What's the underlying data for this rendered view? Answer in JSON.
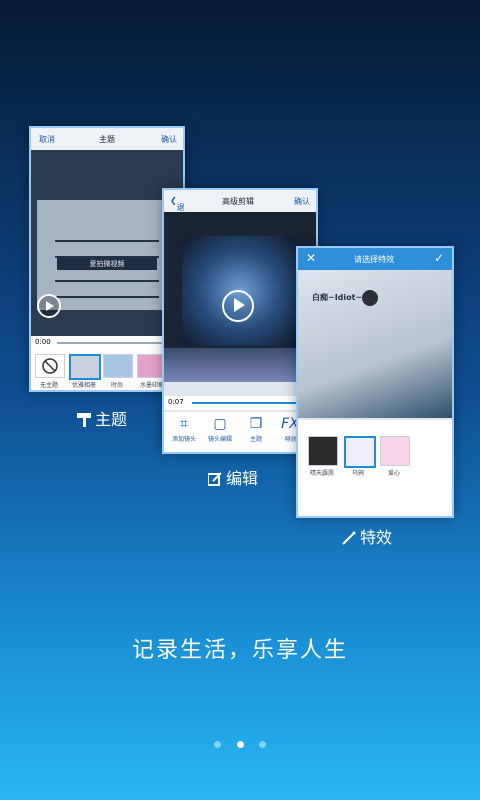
{
  "card_theme": {
    "cancel": "取消",
    "title": "主题",
    "confirm": "确认",
    "caption": "爱拍微视频",
    "time": "0:00",
    "items": [
      {
        "label": "无主题"
      },
      {
        "label": "优雅相册"
      },
      {
        "label": "时尚"
      },
      {
        "label": "水墨印象"
      }
    ]
  },
  "card_edit": {
    "back": "退出",
    "title": "高级剪辑",
    "confirm": "确认",
    "time": "0:07",
    "tools": [
      {
        "label": "添加镜头"
      },
      {
        "label": "镜头编辑"
      },
      {
        "label": "主题"
      },
      {
        "icon": "FX",
        "label": "特效"
      }
    ]
  },
  "card_effect": {
    "title": "请选择特效",
    "photo_text": "白痴~Idiot~",
    "items": [
      {
        "label": "晴天霹雳"
      },
      {
        "label": "乌鸦"
      },
      {
        "label": "爱心"
      }
    ]
  },
  "features": {
    "theme": "主题",
    "edit": "编辑",
    "effect": "特效"
  },
  "slogan": "记录生活，乐享人生",
  "pager": {
    "count": 3,
    "active": 1
  }
}
